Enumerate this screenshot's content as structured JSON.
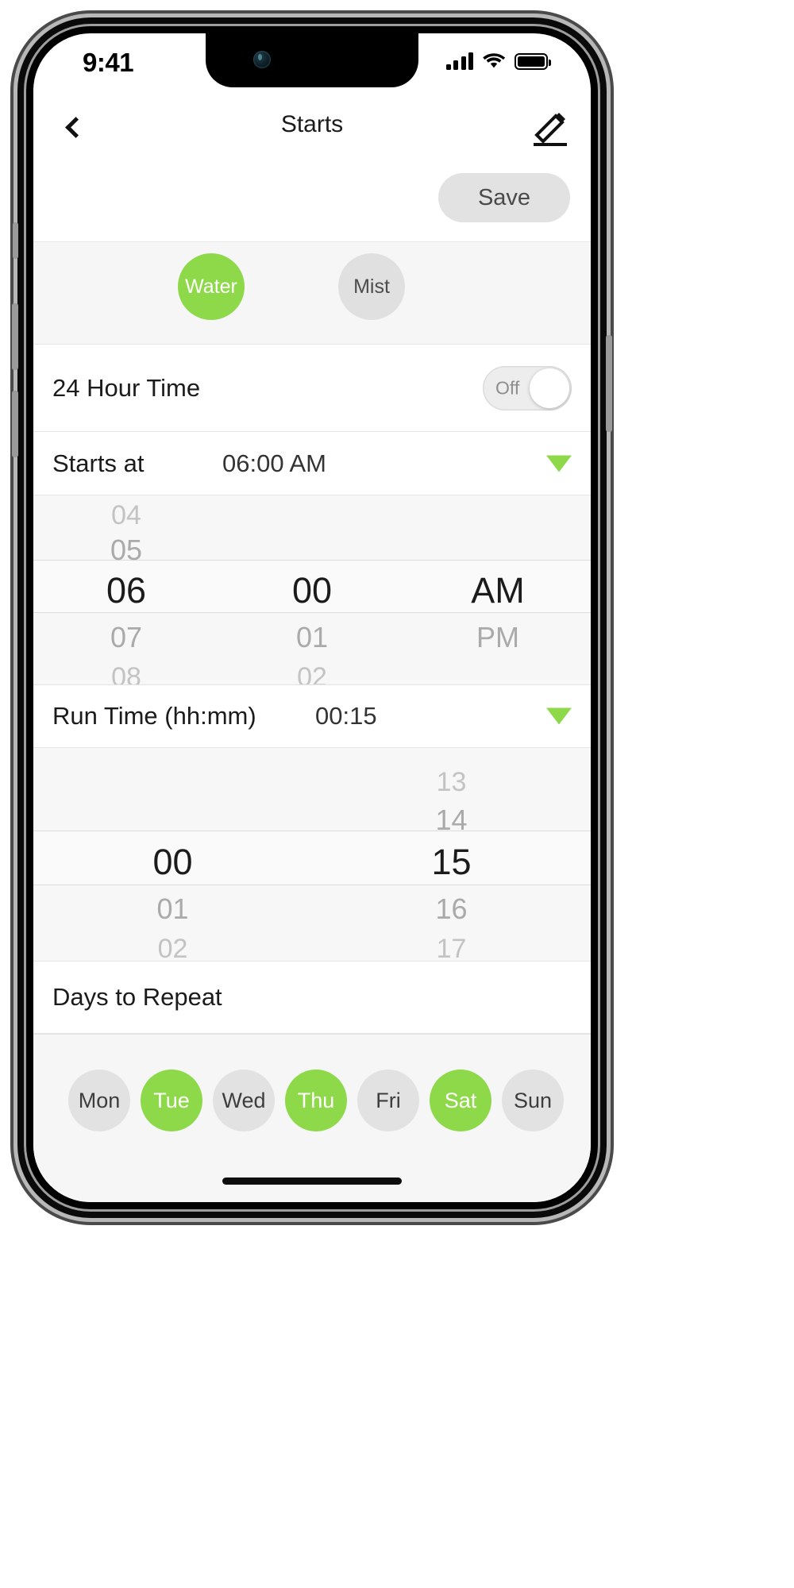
{
  "status_bar": {
    "time": "9:41",
    "signal_icon": "cellular-signal-icon",
    "wifi_icon": "wifi-icon",
    "battery_icon": "battery-full-icon"
  },
  "nav_bar": {
    "back_icon": "back-chevron-icon",
    "title": "Starts",
    "edit_icon": "pencil-edit-icon"
  },
  "toolbar": {
    "save_label": "Save"
  },
  "mode_selector": {
    "options": [
      {
        "label": "Water",
        "selected": true,
        "color": "#8ed94a"
      },
      {
        "label": "Mist",
        "selected": false,
        "color": "#e0e0e0"
      }
    ]
  },
  "rows": {
    "hour_format": {
      "label": "24 Hour Time",
      "toggle_state": "Off"
    },
    "starts_at": {
      "label": "Starts at",
      "value": "06:00 AM",
      "caret_icon": "caret-down-icon"
    },
    "run_time": {
      "label": "Run Time (hh:mm)",
      "value": "00:15",
      "caret_icon": "caret-down-icon"
    },
    "days_header": {
      "label": "Days to Repeat"
    }
  },
  "start_picker": {
    "hours": {
      "far_above": "04",
      "near_above": "05",
      "selected": "06",
      "near_below": "07",
      "far_below": "08"
    },
    "minutes": {
      "far_above": "",
      "near_above": "",
      "selected": "00",
      "near_below": "01",
      "far_below": "02"
    },
    "meridiem": {
      "far_above": "",
      "near_above": "",
      "selected": "AM",
      "near_below": "PM",
      "far_below": ""
    }
  },
  "runtime_picker": {
    "hours": {
      "far_above": "",
      "near_above": "",
      "selected": "00",
      "near_below": "01",
      "far_below": "02"
    },
    "minutes": {
      "far_above": "",
      "near_above": "14",
      "selected": "15",
      "near_below": "16",
      "far_below": "17",
      "far_above_extra": "13"
    }
  },
  "days": [
    {
      "label": "Mon",
      "selected": false
    },
    {
      "label": "Tue",
      "selected": true
    },
    {
      "label": "Wed",
      "selected": false
    },
    {
      "label": "Thu",
      "selected": true
    },
    {
      "label": "Fri",
      "selected": false
    },
    {
      "label": "Sat",
      "selected": true
    },
    {
      "label": "Sun",
      "selected": false
    }
  ],
  "colors": {
    "accent_green": "#8ed94a",
    "pill_gray": "#e2e2e2",
    "panel_gray": "#f6f6f6"
  },
  "home_indicator": "home-indicator-bar"
}
